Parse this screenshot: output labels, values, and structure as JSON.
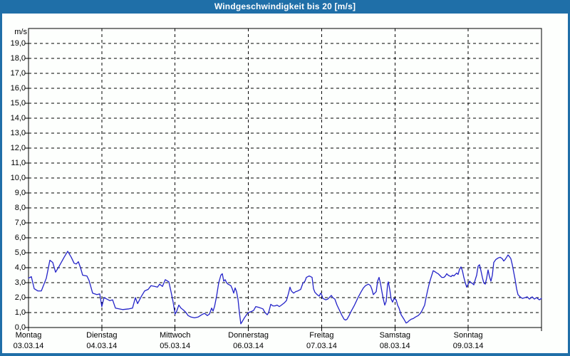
{
  "window": {
    "title": "Windgeschwindigkeit bis 20 [m/s]"
  },
  "colors": {
    "title_bar": "#1f6fa8",
    "frame": "#1f6fa8",
    "line": "#2323c8",
    "grid": "#000000",
    "text": "#000000",
    "background": "#fdfffd"
  },
  "chart_data": {
    "type": "line",
    "title": "Windgeschwindigkeit bis 20 [m/s]",
    "ylabel": "m/s",
    "ylim": [
      0,
      20
    ],
    "y_tick_step": 1.0,
    "y_tick_labels": [
      "0,0",
      "1,0",
      "2,0",
      "3,0",
      "4,0",
      "5,0",
      "6,0",
      "7,0",
      "8,0",
      "9,0",
      "10,0",
      "11,0",
      "12,0",
      "13,0",
      "14,0",
      "15,0",
      "16,0",
      "17,0",
      "18,0",
      "19,0"
    ],
    "grid": "dashed",
    "legend": "none",
    "xlim_days": [
      0,
      7
    ],
    "x_days": [
      {
        "label": "Montag",
        "date": "03.03.14"
      },
      {
        "label": "Dienstag",
        "date": "04.03.14"
      },
      {
        "label": "Mittwoch",
        "date": "05.03.14"
      },
      {
        "label": "Donnerstag",
        "date": "06.03.14"
      },
      {
        "label": "Freitag",
        "date": "07.03.14"
      },
      {
        "label": "Samstag",
        "date": "08.03.14"
      },
      {
        "label": "Sonntag",
        "date": "09.03.14"
      }
    ],
    "series": [
      {
        "name": "Windgeschwindigkeit [m/s]",
        "points": [
          [
            0.0,
            3.3
          ],
          [
            0.039,
            3.4
          ],
          [
            0.078,
            2.6
          ],
          [
            0.126,
            2.45
          ],
          [
            0.175,
            2.45
          ],
          [
            0.243,
            3.3
          ],
          [
            0.292,
            4.5
          ],
          [
            0.331,
            4.35
          ],
          [
            0.369,
            3.7
          ],
          [
            0.418,
            4.1
          ],
          [
            0.486,
            4.7
          ],
          [
            0.535,
            5.1
          ],
          [
            0.583,
            4.7
          ],
          [
            0.622,
            4.3
          ],
          [
            0.651,
            4.25
          ],
          [
            0.681,
            4.4
          ],
          [
            0.71,
            4.0
          ],
          [
            0.739,
            3.5
          ],
          [
            0.797,
            3.45
          ],
          [
            0.826,
            3.15
          ],
          [
            0.875,
            2.3
          ],
          [
            0.933,
            2.2
          ],
          [
            0.972,
            2.25
          ],
          [
            1.0,
            1.4
          ],
          [
            1.031,
            2.0
          ],
          [
            1.069,
            1.9
          ],
          [
            1.108,
            1.8
          ],
          [
            1.147,
            1.85
          ],
          [
            1.186,
            1.3
          ],
          [
            1.283,
            1.2
          ],
          [
            1.371,
            1.25
          ],
          [
            1.419,
            1.3
          ],
          [
            1.458,
            2.0
          ],
          [
            1.488,
            1.6
          ],
          [
            1.536,
            2.05
          ],
          [
            1.585,
            2.45
          ],
          [
            1.633,
            2.55
          ],
          [
            1.672,
            2.8
          ],
          [
            1.721,
            2.75
          ],
          [
            1.76,
            2.7
          ],
          [
            1.789,
            2.9
          ],
          [
            1.828,
            2.75
          ],
          [
            1.867,
            3.2
          ],
          [
            1.915,
            3.05
          ],
          [
            1.944,
            2.4
          ],
          [
            1.974,
            1.7
          ],
          [
            2.0,
            0.9
          ],
          [
            2.022,
            1.1
          ],
          [
            2.051,
            1.5
          ],
          [
            2.081,
            1.3
          ],
          [
            2.119,
            1.15
          ],
          [
            2.149,
            1.0
          ],
          [
            2.178,
            0.8
          ],
          [
            2.217,
            0.7
          ],
          [
            2.265,
            0.65
          ],
          [
            2.314,
            0.7
          ],
          [
            2.363,
            0.85
          ],
          [
            2.401,
            0.95
          ],
          [
            2.44,
            0.8
          ],
          [
            2.469,
            0.9
          ],
          [
            2.499,
            1.3
          ],
          [
            2.518,
            1.1
          ],
          [
            2.538,
            1.4
          ],
          [
            2.567,
            2.1
          ],
          [
            2.596,
            3.0
          ],
          [
            2.625,
            3.5
          ],
          [
            2.644,
            3.6
          ],
          [
            2.664,
            3.1
          ],
          [
            2.683,
            3.2
          ],
          [
            2.703,
            3.0
          ],
          [
            2.722,
            2.9
          ],
          [
            2.761,
            2.8
          ],
          [
            2.78,
            2.6
          ],
          [
            2.8,
            2.3
          ],
          [
            2.819,
            2.65
          ],
          [
            2.839,
            2.4
          ],
          [
            2.858,
            1.9
          ],
          [
            2.878,
            1.0
          ],
          [
            2.897,
            0.25
          ],
          [
            2.917,
            0.4
          ],
          [
            2.946,
            0.65
          ],
          [
            2.975,
            0.85
          ],
          [
            3.0,
            1.0
          ],
          [
            3.033,
            1.05
          ],
          [
            3.072,
            1.15
          ],
          [
            3.101,
            1.4
          ],
          [
            3.14,
            1.35
          ],
          [
            3.169,
            1.3
          ],
          [
            3.199,
            1.25
          ],
          [
            3.228,
            1.0
          ],
          [
            3.257,
            0.85
          ],
          [
            3.276,
            1.0
          ],
          [
            3.306,
            1.55
          ],
          [
            3.335,
            1.45
          ],
          [
            3.364,
            1.45
          ],
          [
            3.393,
            1.5
          ],
          [
            3.422,
            1.4
          ],
          [
            3.451,
            1.5
          ],
          [
            3.49,
            1.65
          ],
          [
            3.519,
            1.8
          ],
          [
            3.549,
            2.3
          ],
          [
            3.568,
            2.7
          ],
          [
            3.587,
            2.45
          ],
          [
            3.617,
            2.3
          ],
          [
            3.646,
            2.4
          ],
          [
            3.675,
            2.45
          ],
          [
            3.714,
            2.55
          ],
          [
            3.743,
            2.95
          ],
          [
            3.772,
            3.1
          ],
          [
            3.792,
            3.35
          ],
          [
            3.831,
            3.45
          ],
          [
            3.869,
            3.35
          ],
          [
            3.889,
            2.6
          ],
          [
            3.908,
            2.35
          ],
          [
            3.938,
            2.2
          ],
          [
            3.967,
            2.1
          ],
          [
            3.986,
            2.3
          ],
          [
            4.0,
            2.2
          ],
          [
            4.015,
            1.95
          ],
          [
            4.054,
            1.85
          ],
          [
            4.083,
            1.9
          ],
          [
            4.113,
            2.05
          ],
          [
            4.132,
            2.15
          ],
          [
            4.151,
            2.0
          ],
          [
            4.181,
            1.9
          ],
          [
            4.21,
            1.5
          ],
          [
            4.249,
            1.1
          ],
          [
            4.278,
            0.8
          ],
          [
            4.307,
            0.55
          ],
          [
            4.326,
            0.5
          ],
          [
            4.346,
            0.55
          ],
          [
            4.375,
            0.8
          ],
          [
            4.404,
            1.1
          ],
          [
            4.443,
            1.45
          ],
          [
            4.472,
            1.75
          ],
          [
            4.501,
            2.05
          ],
          [
            4.54,
            2.4
          ],
          [
            4.569,
            2.65
          ],
          [
            4.599,
            2.8
          ],
          [
            4.638,
            2.9
          ],
          [
            4.667,
            2.8
          ],
          [
            4.686,
            2.55
          ],
          [
            4.706,
            2.2
          ],
          [
            4.725,
            2.3
          ],
          [
            4.744,
            2.4
          ],
          [
            4.764,
            3.1
          ],
          [
            4.783,
            3.35
          ],
          [
            4.803,
            2.95
          ],
          [
            4.822,
            2.4
          ],
          [
            4.842,
            1.9
          ],
          [
            4.861,
            1.5
          ],
          [
            4.881,
            1.75
          ],
          [
            4.9,
            2.9
          ],
          [
            4.91,
            3.05
          ],
          [
            4.929,
            2.55
          ],
          [
            4.949,
            1.9
          ],
          [
            4.968,
            1.7
          ],
          [
            4.988,
            1.95
          ],
          [
            5.0,
            1.9
          ],
          [
            5.017,
            1.85
          ],
          [
            5.036,
            1.5
          ],
          [
            5.056,
            1.3
          ],
          [
            5.085,
            0.85
          ],
          [
            5.124,
            0.55
          ],
          [
            5.153,
            0.3
          ],
          [
            5.172,
            0.35
          ],
          [
            5.192,
            0.45
          ],
          [
            5.221,
            0.55
          ],
          [
            5.25,
            0.6
          ],
          [
            5.279,
            0.7
          ],
          [
            5.318,
            0.8
          ],
          [
            5.347,
            0.95
          ],
          [
            5.367,
            1.1
          ],
          [
            5.386,
            1.3
          ],
          [
            5.406,
            1.5
          ],
          [
            5.425,
            2.0
          ],
          [
            5.444,
            2.45
          ],
          [
            5.464,
            2.85
          ],
          [
            5.483,
            3.2
          ],
          [
            5.503,
            3.5
          ],
          [
            5.522,
            3.8
          ],
          [
            5.542,
            3.75
          ],
          [
            5.571,
            3.65
          ],
          [
            5.59,
            3.6
          ],
          [
            5.61,
            3.5
          ],
          [
            5.639,
            3.35
          ],
          [
            5.668,
            3.35
          ],
          [
            5.688,
            3.45
          ],
          [
            5.707,
            3.6
          ],
          [
            5.726,
            3.5
          ],
          [
            5.746,
            3.45
          ],
          [
            5.765,
            3.4
          ],
          [
            5.785,
            3.5
          ],
          [
            5.804,
            3.45
          ],
          [
            5.824,
            3.55
          ],
          [
            5.843,
            3.65
          ],
          [
            5.862,
            3.55
          ],
          [
            5.882,
            3.9
          ],
          [
            5.901,
            4.05
          ],
          [
            5.921,
            3.8
          ],
          [
            5.94,
            3.35
          ],
          [
            5.96,
            3.0
          ],
          [
            5.979,
            2.7
          ],
          [
            6.0,
            2.9
          ],
          [
            6.018,
            3.1
          ],
          [
            6.038,
            3.0
          ],
          [
            6.057,
            2.95
          ],
          [
            6.076,
            2.85
          ],
          [
            6.096,
            3.2
          ],
          [
            6.115,
            3.5
          ],
          [
            6.135,
            4.1
          ],
          [
            6.154,
            4.2
          ],
          [
            6.174,
            3.8
          ],
          [
            6.193,
            3.35
          ],
          [
            6.212,
            3.0
          ],
          [
            6.232,
            2.9
          ],
          [
            6.251,
            3.3
          ],
          [
            6.271,
            3.85
          ],
          [
            6.29,
            3.4
          ],
          [
            6.31,
            3.1
          ],
          [
            6.329,
            3.5
          ],
          [
            6.349,
            4.35
          ],
          [
            6.378,
            4.55
          ],
          [
            6.407,
            4.65
          ],
          [
            6.436,
            4.7
          ],
          [
            6.465,
            4.6
          ],
          [
            6.485,
            4.45
          ],
          [
            6.504,
            4.55
          ],
          [
            6.524,
            4.7
          ],
          [
            6.543,
            4.85
          ],
          [
            6.562,
            4.75
          ],
          [
            6.582,
            4.6
          ],
          [
            6.601,
            4.2
          ],
          [
            6.621,
            3.7
          ],
          [
            6.64,
            3.2
          ],
          [
            6.66,
            2.6
          ],
          [
            6.679,
            2.2
          ],
          [
            6.708,
            2.05
          ],
          [
            6.738,
            1.95
          ],
          [
            6.776,
            2.0
          ],
          [
            6.806,
            2.05
          ],
          [
            6.835,
            1.9
          ],
          [
            6.874,
            2.05
          ],
          [
            6.903,
            1.9
          ],
          [
            6.932,
            2.0
          ],
          [
            6.971,
            1.85
          ],
          [
            7.0,
            1.95
          ]
        ]
      }
    ]
  }
}
